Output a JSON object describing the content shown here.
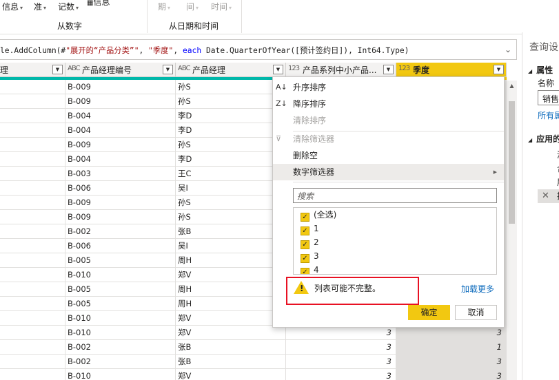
{
  "ribbon": {
    "items": [
      {
        "label": "信息",
        "caret": true,
        "disabled": false
      },
      {
        "label": "准",
        "caret": true,
        "disabled": false
      },
      {
        "label": "记数",
        "caret": true,
        "disabled": false
      },
      {
        "label": "信息",
        "caret": false,
        "disabled": false
      },
      {
        "label": "期",
        "caret": true,
        "disabled": true
      },
      {
        "label": "间",
        "caret": true,
        "disabled": true
      },
      {
        "label": "时间",
        "caret": true,
        "disabled": true
      }
    ],
    "groups": [
      "从数字",
      "从日期和时间"
    ]
  },
  "formula": {
    "prefix": "le.AddColumn(#",
    "s1": "\"展开的“产品分类”\"",
    "comma1": ", ",
    "s2": "\"季度\"",
    "comma2": ", ",
    "kw": "each",
    "rest": " Date.QuarterOfYear([预计签约日]), Int64.Type)"
  },
  "columns": [
    {
      "type": "",
      "label": "理"
    },
    {
      "type": "ABC",
      "label": "产品经理编号"
    },
    {
      "type": "ABC",
      "label": "产品经理"
    },
    {
      "type": "123",
      "label": "产品系列中小产品..."
    },
    {
      "type": "123",
      "label": "季度"
    }
  ],
  "rows": [
    [
      "B-009",
      "孙S",
      "",
      ""
    ],
    [
      "B-009",
      "孙S",
      "",
      ""
    ],
    [
      "B-004",
      "李D",
      "",
      ""
    ],
    [
      "B-004",
      "李D",
      "",
      ""
    ],
    [
      "B-009",
      "孙S",
      "",
      ""
    ],
    [
      "B-004",
      "李D",
      "",
      ""
    ],
    [
      "B-003",
      "王C",
      "",
      ""
    ],
    [
      "B-006",
      "吴I",
      "",
      ""
    ],
    [
      "B-009",
      "孙S",
      "",
      ""
    ],
    [
      "B-009",
      "孙S",
      "",
      ""
    ],
    [
      "B-002",
      "张B",
      "",
      ""
    ],
    [
      "B-006",
      "吴I",
      "",
      ""
    ],
    [
      "B-005",
      "周H",
      "",
      ""
    ],
    [
      "B-010",
      "郑V",
      "",
      ""
    ],
    [
      "B-005",
      "周H",
      "",
      ""
    ],
    [
      "B-005",
      "周H",
      "",
      ""
    ],
    [
      "B-010",
      "郑V",
      "",
      ""
    ],
    [
      "B-010",
      "郑V",
      "3",
      "3"
    ],
    [
      "B-002",
      "张B",
      "3",
      "1"
    ],
    [
      "B-002",
      "张B",
      "3",
      "3"
    ],
    [
      "B-010",
      "郑V",
      "3",
      "3"
    ]
  ],
  "menu": {
    "items": [
      {
        "label": "升序排序",
        "icon": "sort-ascending-icon",
        "glyph": "A↓Z",
        "disabled": false
      },
      {
        "label": "降序排序",
        "icon": "sort-descending-icon",
        "glyph": "Z↓A",
        "disabled": false
      },
      {
        "label": "清除排序",
        "icon": "",
        "glyph": "",
        "disabled": true
      },
      {
        "label": "清除筛选器",
        "icon": "clear-filter-icon",
        "glyph": "⊽",
        "disabled": true
      },
      {
        "label": "删除空",
        "icon": "",
        "glyph": "",
        "disabled": false
      },
      {
        "label": "数字筛选器",
        "icon": "",
        "glyph": "",
        "disabled": false,
        "submenu": true
      }
    ],
    "search_placeholder": "搜索",
    "filter_values": [
      {
        "label": "(全选)",
        "checked": true
      },
      {
        "label": "1",
        "checked": true
      },
      {
        "label": "2",
        "checked": true
      },
      {
        "label": "3",
        "checked": true
      },
      {
        "label": "4",
        "checked": true
      }
    ],
    "warning": "列表可能不完整。",
    "load_more": "加载更多",
    "ok": "确定",
    "cancel": "取消"
  },
  "right_pane": {
    "title": "查询设",
    "properties": "属性",
    "name_label": "名称",
    "name_value": "销售",
    "all_props": "所有属",
    "applied_steps": "应用的",
    "steps": [
      "源",
      "合",
      "展",
      "插"
    ]
  },
  "colors": {
    "accent": "#f2c811",
    "quality_bar": "#01b8aa",
    "warning_box": "#e81123"
  }
}
